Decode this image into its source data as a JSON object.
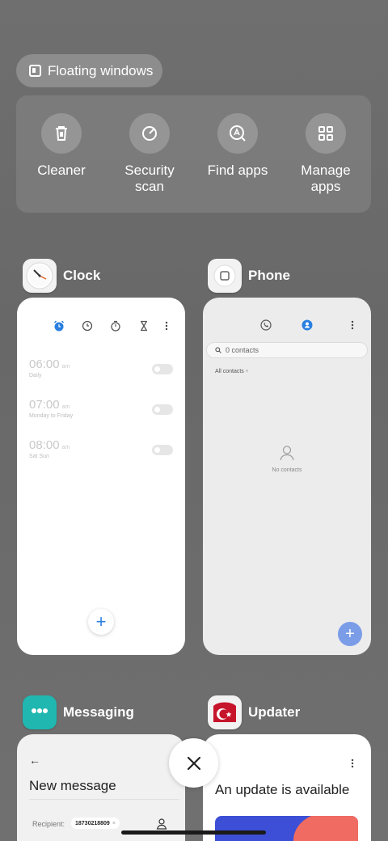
{
  "floating": {
    "label": "Floating windows",
    "icon": "floating-window-icon"
  },
  "quick_actions": [
    {
      "label": "Cleaner",
      "icon": "trash-icon"
    },
    {
      "label": "Security\nscan",
      "line1": "Security",
      "line2": "scan",
      "icon": "security-scan-icon"
    },
    {
      "label": "Find apps",
      "icon": "find-apps-icon"
    },
    {
      "label": "Manage apps",
      "line1": "Manage",
      "line2": "apps",
      "icon": "grid-icon"
    }
  ],
  "apps": {
    "clock": {
      "name": "Clock",
      "alarms": [
        {
          "time": "06:00",
          "ampm": "am",
          "repeat": "Daily"
        },
        {
          "time": "07:00",
          "ampm": "am",
          "repeat": "Monday to Friday"
        },
        {
          "time": "08:00",
          "ampm": "am",
          "repeat": "Sat Sun"
        }
      ],
      "fab": "+"
    },
    "phone": {
      "name": "Phone",
      "search_placeholder": "0 contacts",
      "filter_label": "All contacts",
      "empty_text": "No contacts",
      "fab": "+"
    },
    "messaging": {
      "name": "Messaging",
      "title": "New message",
      "recipient_label": "Recipient:",
      "recipient_value": "18730218809",
      "chip_close": "×"
    },
    "updater": {
      "name": "Updater",
      "title": "An update is available"
    }
  },
  "colors": {
    "accent": "#2a7fe0",
    "fab_blue": "#7b9de8",
    "banner_blue": "#3c4fd6",
    "banner_red": "#f06b62"
  }
}
